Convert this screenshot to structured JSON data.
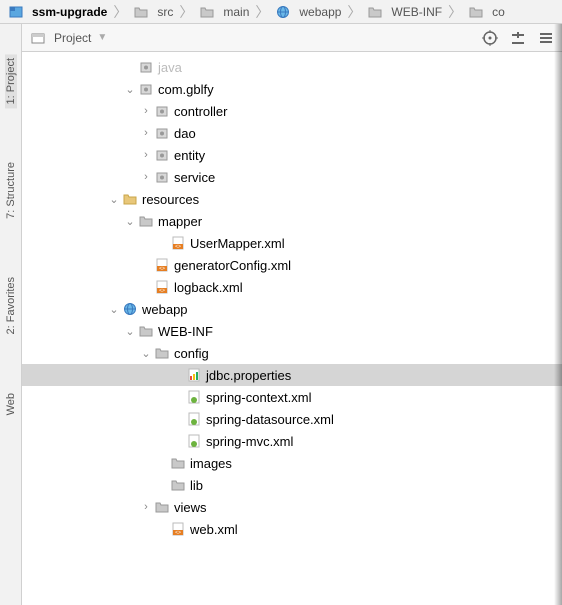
{
  "breadcrumb": [
    {
      "label": "ssm-upgrade",
      "icon": "module"
    },
    {
      "label": "src",
      "icon": "folder"
    },
    {
      "label": "main",
      "icon": "folder"
    },
    {
      "label": "webapp",
      "icon": "webfolder"
    },
    {
      "label": "WEB-INF",
      "icon": "folder"
    },
    {
      "label": "co",
      "icon": "folder"
    }
  ],
  "panel": {
    "title": "Project"
  },
  "gutter": {
    "project": "1: Project",
    "structure": "7: Structure",
    "favorites": "2: Favorites",
    "web": "Web"
  },
  "tree": [
    {
      "indent": 5,
      "arrow": "",
      "icon": "package",
      "label": "java",
      "faded": true
    },
    {
      "indent": 5,
      "arrow": "v",
      "icon": "package",
      "label": "com.gblfy"
    },
    {
      "indent": 6,
      "arrow": ">",
      "icon": "package",
      "label": "controller"
    },
    {
      "indent": 6,
      "arrow": ">",
      "icon": "package",
      "label": "dao"
    },
    {
      "indent": 6,
      "arrow": ">",
      "icon": "package",
      "label": "entity"
    },
    {
      "indent": 6,
      "arrow": ">",
      "icon": "package",
      "label": "service"
    },
    {
      "indent": 4,
      "arrow": "v",
      "icon": "resfolder",
      "label": "resources"
    },
    {
      "indent": 5,
      "arrow": "v",
      "icon": "folder",
      "label": "mapper"
    },
    {
      "indent": 7,
      "arrow": "",
      "icon": "xml",
      "label": "UserMapper.xml"
    },
    {
      "indent": 6,
      "arrow": "",
      "icon": "xml",
      "label": "generatorConfig.xml"
    },
    {
      "indent": 6,
      "arrow": "",
      "icon": "xml",
      "label": "logback.xml"
    },
    {
      "indent": 4,
      "arrow": "v",
      "icon": "webfolder",
      "label": "webapp"
    },
    {
      "indent": 5,
      "arrow": "v",
      "icon": "folder",
      "label": "WEB-INF"
    },
    {
      "indent": 6,
      "arrow": "v",
      "icon": "folder",
      "label": "config"
    },
    {
      "indent": 8,
      "arrow": "",
      "icon": "props",
      "label": "jdbc.properties",
      "selected": true
    },
    {
      "indent": 8,
      "arrow": "",
      "icon": "spring",
      "label": "spring-context.xml"
    },
    {
      "indent": 8,
      "arrow": "",
      "icon": "spring",
      "label": "spring-datasource.xml"
    },
    {
      "indent": 8,
      "arrow": "",
      "icon": "spring",
      "label": "spring-mvc.xml"
    },
    {
      "indent": 7,
      "arrow": "",
      "icon": "folder",
      "label": "images"
    },
    {
      "indent": 7,
      "arrow": "",
      "icon": "folder",
      "label": "lib"
    },
    {
      "indent": 6,
      "arrow": ">",
      "icon": "folder",
      "label": "views"
    },
    {
      "indent": 7,
      "arrow": "",
      "icon": "xml",
      "label": "web.xml"
    }
  ]
}
